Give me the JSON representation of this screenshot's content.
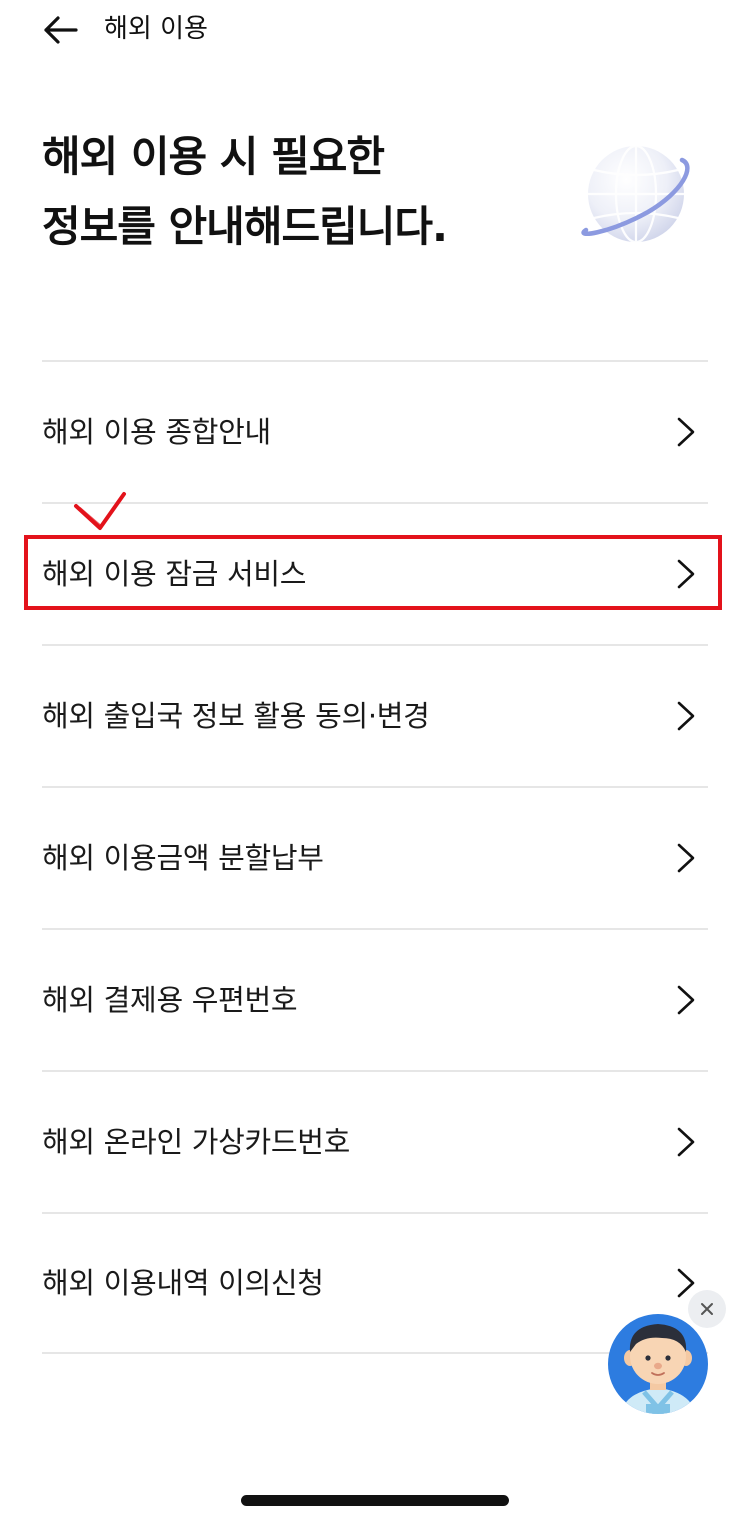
{
  "header": {
    "title": "해외 이용",
    "back_icon": "arrow-left-icon"
  },
  "hero": {
    "title_line1": "해외 이용 시 필요한",
    "title_line2": "정보를 안내해드립니다.",
    "illustration_icon": "globe-icon"
  },
  "menu": {
    "chevron_icon": "chevron-right-icon",
    "items": [
      {
        "label": "해외 이용 종합안내"
      },
      {
        "label": "해외 이용 잠금 서비스"
      },
      {
        "label": "해외 출입국 정보 활용 동의·변경"
      },
      {
        "label": "해외 이용금액 분할납부"
      },
      {
        "label": "해외 결제용 우편번호"
      },
      {
        "label": "해외 온라인 가상카드번호"
      },
      {
        "label": "해외 이용내역 이의신청"
      }
    ]
  },
  "annotation": {
    "highlighted_item": "해외 이용 잠금 서비스",
    "color": "#e3121b"
  },
  "chatbot": {
    "close_icon": "close-icon",
    "avatar_icon": "chatbot-avatar-icon"
  },
  "colors": {
    "divider": "#e6e6e6",
    "text": "#111111",
    "globe_ring": "#8c9ae0"
  }
}
